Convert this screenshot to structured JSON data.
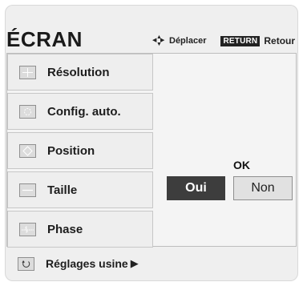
{
  "header": {
    "title": "ÉCRAN",
    "move_label": "Déplacer",
    "return_badge": "RETURN",
    "return_label": "Retour"
  },
  "menu": {
    "items": [
      {
        "label": "Résolution",
        "icon": "resolution-icon"
      },
      {
        "label": "Config. auto.",
        "icon": "auto-config-icon"
      },
      {
        "label": "Position",
        "icon": "position-icon"
      },
      {
        "label": "Taille",
        "icon": "size-icon"
      },
      {
        "label": "Phase",
        "icon": "phase-icon"
      }
    ],
    "reset_label": "Réglages usine",
    "reset_arrow": "▶"
  },
  "confirm": {
    "prompt": "OK",
    "yes_label": "Oui",
    "no_label": "Non"
  }
}
